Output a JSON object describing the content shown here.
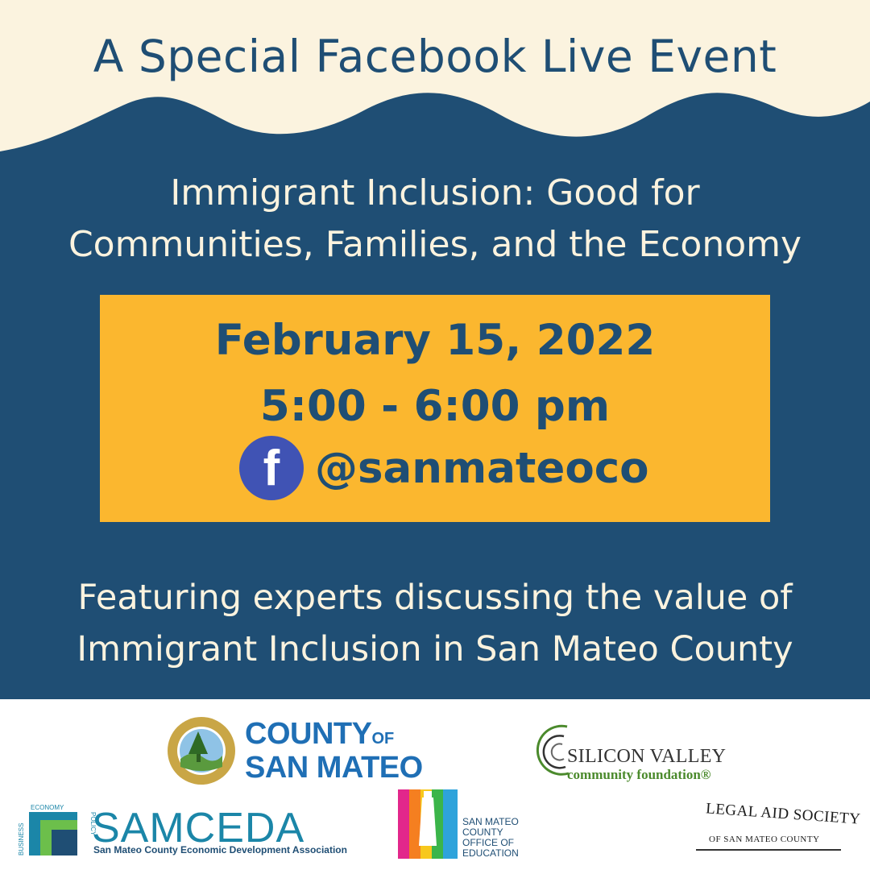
{
  "header": {
    "title": "A Special Facebook Live Event"
  },
  "subtitle": {
    "line1": "Immigrant Inclusion: Good for",
    "line2": "Communities, Families, and the Economy"
  },
  "event": {
    "date": "February 15, 2022",
    "time": "5:00 - 6:00 pm",
    "facebook_glyph": "f",
    "handle": "@sanmateoco"
  },
  "featuring": {
    "line1": "Featuring experts discussing the value of",
    "line2": "Immigrant Inclusion in San Mateo County"
  },
  "sponsors": {
    "county": {
      "line1": "COUNTY",
      "of": "OF",
      "line2": "SAN MATEO"
    },
    "svcf": {
      "name": "SILICON VALLEY",
      "sub": "community foundation®"
    },
    "samceda": {
      "name": "SAMCEDA",
      "sub": "San Mateo County Economic Development Association",
      "economy": "ECONOMY",
      "business": "BUSINESS",
      "policy": "POLICY"
    },
    "smcoe": {
      "line1": "SAN MATEO",
      "line2": "COUNTY",
      "line3": "OFFICE OF",
      "line4": "EDUCATION"
    },
    "legal_aid": {
      "top": "LEGAL AID SOCIETY",
      "bottom": "OF SAN MATEO COUNTY"
    }
  },
  "colors": {
    "navy": "#1f4e74",
    "cream": "#fbf3df",
    "gold": "#fbb72f",
    "facebook": "#4053b4"
  },
  "icons": {
    "facebook": "facebook-icon"
  }
}
